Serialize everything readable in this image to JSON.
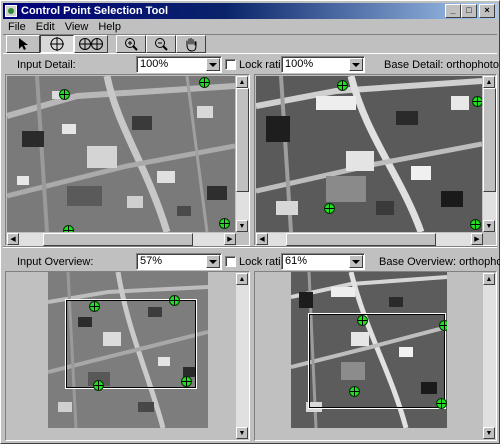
{
  "window": {
    "title": "Control Point Selection Tool",
    "controls": {
      "minimize": "_",
      "maximize": "□",
      "close": "×"
    }
  },
  "menu": [
    "File",
    "Edit",
    "View",
    "Help"
  ],
  "toolbar": [
    {
      "name": "select-pointer",
      "glyph": "↖",
      "pressed": false
    },
    {
      "name": "add-point",
      "glyph": "⊕",
      "pressed": true
    },
    {
      "name": "add-pair",
      "glyph": "⊕⊕",
      "pressed": false
    },
    {
      "name": "zoom-in",
      "glyph": "🔍+",
      "pressed": false
    },
    {
      "name": "zoom-out",
      "glyph": "🔍−",
      "pressed": false
    },
    {
      "name": "pan",
      "glyph": "✋",
      "pressed": false
    }
  ],
  "detail": {
    "input_label": "Input Detail:",
    "input_zoom": "100%",
    "lock_label": "Lock ratio",
    "lock_checked": false,
    "base_zoom": "100%",
    "base_label": "Base Detail: orthophoto"
  },
  "overview": {
    "input_label": "Input Overview:",
    "input_zoom": "57%",
    "lock_label": "Lock ratio",
    "lock_checked": false,
    "base_zoom": "61%",
    "base_label": "Base Overview: orthophoto"
  },
  "colors": {
    "control_point": "#22dd22",
    "titlebar_start": "#00007b",
    "titlebar_end": "#a6caf0",
    "chrome": "#c0c0c0"
  }
}
